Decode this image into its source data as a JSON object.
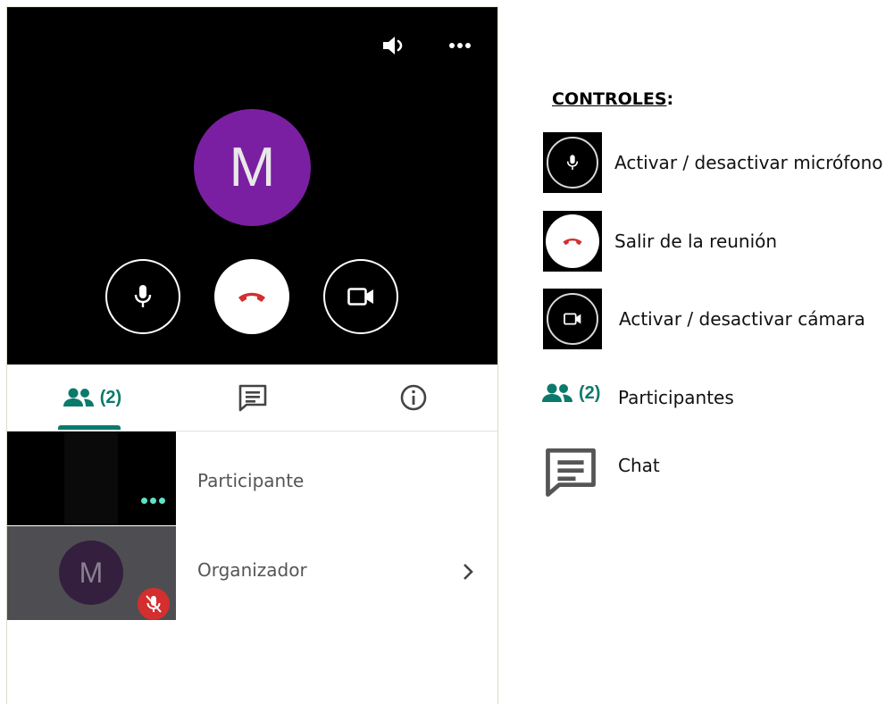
{
  "call": {
    "avatar_letter": "M",
    "top_bar": {
      "speaker_icon": "volume-icon",
      "more_icon": "more-horizontal-icon"
    },
    "controls": [
      {
        "icon": "microphone-icon",
        "action": "toggle-mic"
      },
      {
        "icon": "hang-up-icon",
        "action": "leave"
      },
      {
        "icon": "camera-icon",
        "action": "toggle-camera"
      }
    ]
  },
  "tabs": {
    "people_count": "(2)",
    "people_icon": "people-icon",
    "chat_icon": "chat-icon",
    "info_icon": "info-icon",
    "active": "people"
  },
  "participants": [
    {
      "name": "Participante",
      "thumb": "video"
    },
    {
      "name": "Organizador",
      "avatar_letter": "M",
      "muted": true
    }
  ],
  "legend": {
    "title": "CONTROLES",
    "title_suffix": ":",
    "items": [
      {
        "icon": "microphone-icon",
        "label": "Activar / desactivar micrófono"
      },
      {
        "icon": "hang-up-icon",
        "label": "Salir de la reunión"
      },
      {
        "icon": "camera-icon",
        "label": "Activar / desactivar cámara"
      },
      {
        "icon": "people-icon",
        "count": "(2)",
        "label": "Participantes"
      },
      {
        "icon": "chat-icon",
        "label": "Chat"
      }
    ]
  },
  "colors": {
    "accent": "#0b7a6b",
    "avatar": "#7b1fa2",
    "hangup": "#d32f2f"
  }
}
